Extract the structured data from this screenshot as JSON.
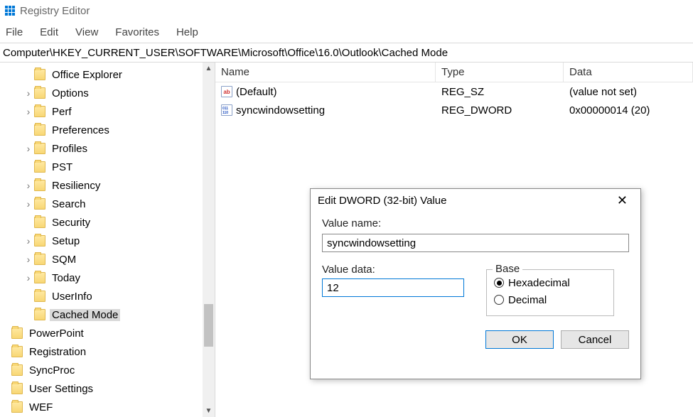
{
  "app_title": "Registry Editor",
  "menu": {
    "file": "File",
    "edit": "Edit",
    "view": "View",
    "favorites": "Favorites",
    "help": "Help"
  },
  "address": "Computer\\HKEY_CURRENT_USER\\SOFTWARE\\Microsoft\\Office\\16.0\\Outlook\\Cached Mode",
  "tree": {
    "items": [
      {
        "label": "Office Explorer",
        "expander": "none",
        "indent": 2
      },
      {
        "label": "Options",
        "expander": "closed",
        "indent": 2
      },
      {
        "label": "Perf",
        "expander": "closed",
        "indent": 2
      },
      {
        "label": "Preferences",
        "expander": "none",
        "indent": 2
      },
      {
        "label": "Profiles",
        "expander": "closed",
        "indent": 2
      },
      {
        "label": "PST",
        "expander": "none",
        "indent": 2
      },
      {
        "label": "Resiliency",
        "expander": "closed",
        "indent": 2
      },
      {
        "label": "Search",
        "expander": "closed",
        "indent": 2
      },
      {
        "label": "Security",
        "expander": "none",
        "indent": 2
      },
      {
        "label": "Setup",
        "expander": "closed",
        "indent": 2
      },
      {
        "label": "SQM",
        "expander": "closed",
        "indent": 2
      },
      {
        "label": "Today",
        "expander": "closed",
        "indent": 2
      },
      {
        "label": "UserInfo",
        "expander": "none",
        "indent": 2
      },
      {
        "label": "Cached Mode",
        "expander": "none",
        "indent": 2,
        "selected": true
      },
      {
        "label": "PowerPoint",
        "expander": "none",
        "indent": 1
      },
      {
        "label": "Registration",
        "expander": "none",
        "indent": 1
      },
      {
        "label": "SyncProc",
        "expander": "none",
        "indent": 1
      },
      {
        "label": "User Settings",
        "expander": "none",
        "indent": 1
      },
      {
        "label": "WEF",
        "expander": "none",
        "indent": 1
      }
    ]
  },
  "list": {
    "headers": {
      "name": "Name",
      "type": "Type",
      "data": "Data"
    },
    "rows": [
      {
        "icon": "sz",
        "icon_text": "ab",
        "name": "(Default)",
        "type": "REG_SZ",
        "data": "(value not set)"
      },
      {
        "icon": "dw",
        "icon_text": "011\n110",
        "name": "syncwindowsetting",
        "type": "REG_DWORD",
        "data": "0x00000014 (20)"
      }
    ]
  },
  "dialog": {
    "title": "Edit DWORD (32-bit) Value",
    "value_name_label": "Value name:",
    "value_name": "syncwindowsetting",
    "value_data_label": "Value data:",
    "value_data": "12",
    "base_label": "Base",
    "hex_label": "Hexadecimal",
    "dec_label": "Decimal",
    "base_selected": "hex",
    "ok": "OK",
    "cancel": "Cancel"
  }
}
